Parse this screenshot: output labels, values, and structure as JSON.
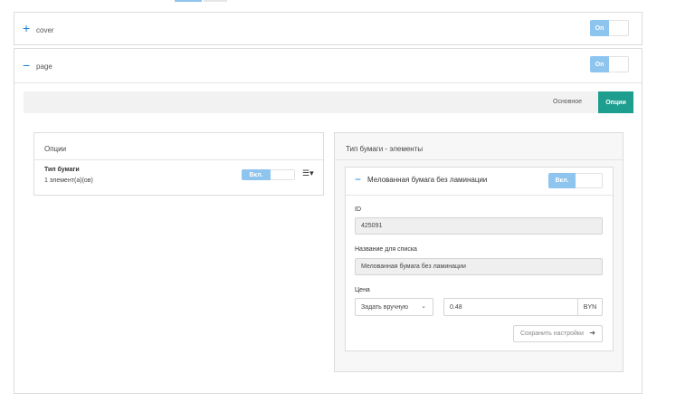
{
  "sections": [
    {
      "sign": "+",
      "name": "cover",
      "toggle": "On"
    },
    {
      "sign": "−",
      "name": "page",
      "toggle": "On"
    }
  ],
  "tabs": {
    "basic": "Основное",
    "options": "Опции"
  },
  "options_panel": {
    "title": "Опции",
    "item_title": "Тип бумаги",
    "item_count": "1 элемент(а)(ов)",
    "item_toggle": "Вкл."
  },
  "elements_panel": {
    "title": "Тип бумаги - элементы",
    "item": {
      "sign": "−",
      "name": "Мелованная бумага без ламинации",
      "toggle": "Вкл.",
      "id_label": "ID",
      "id_value": "425091",
      "list_name_label": "Название для списка",
      "list_name_value": "Мелованная бумага без ламинации",
      "price_label": "Цена",
      "price_mode": "Задать вручную",
      "price_value": "0.48",
      "currency": "BYN",
      "save_button": "Сохранить настройки"
    }
  }
}
